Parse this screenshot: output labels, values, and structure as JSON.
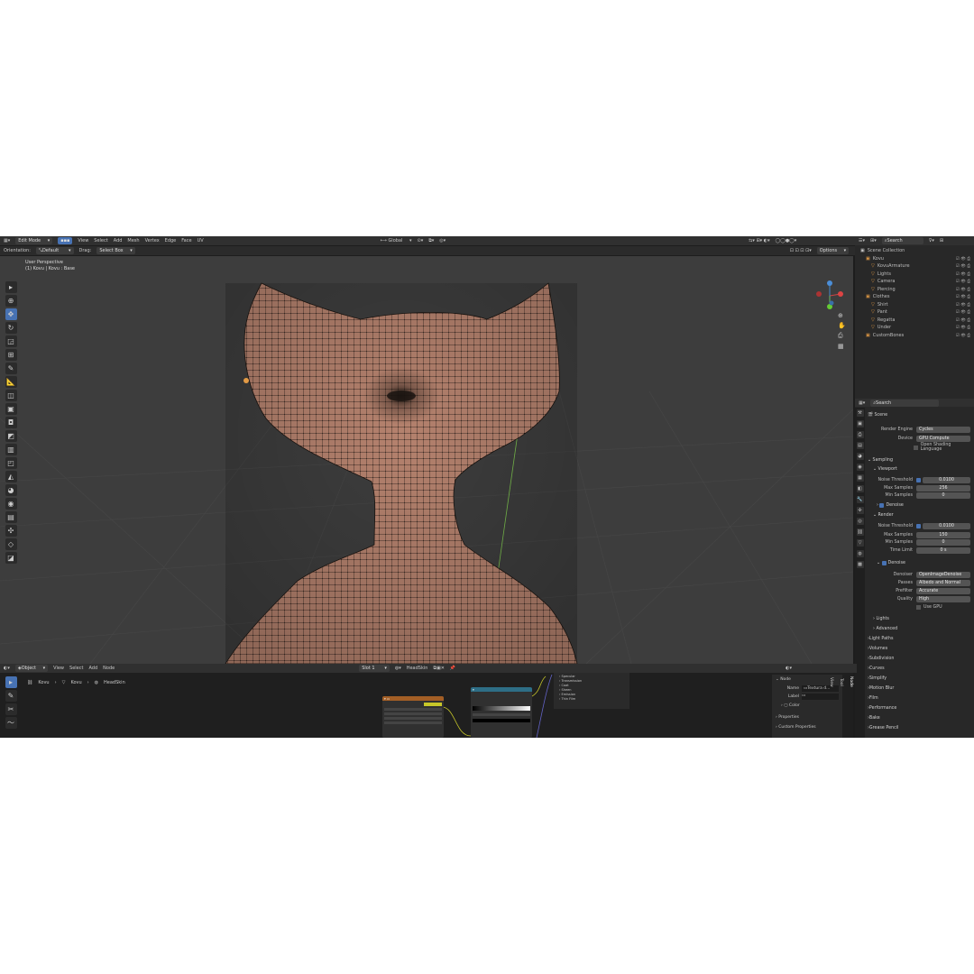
{
  "header": {
    "mode": "Edit Mode",
    "menus": [
      "View",
      "Select",
      "Add",
      "Mesh",
      "Vertex",
      "Edge",
      "Face",
      "UV"
    ],
    "orientation": "Global",
    "options": "Options"
  },
  "tool_header": {
    "orientation_label": "Orientation:",
    "orientation_value": "Default",
    "drag_label": "Drag:",
    "drag_value": "Select Box"
  },
  "viewport": {
    "title": "User Perspective",
    "subtitle": "(1) Kovu | Kovu : Base"
  },
  "outliner": {
    "search_placeholder": "Search",
    "scene_collection": "Scene Collection",
    "items": [
      {
        "name": "Kovu",
        "indent": 1
      },
      {
        "name": "KovuArmature",
        "indent": 2
      },
      {
        "name": "Lights",
        "indent": 2
      },
      {
        "name": "Camera",
        "indent": 2
      },
      {
        "name": "Piercing",
        "indent": 2
      },
      {
        "name": "Clothes",
        "indent": 1
      },
      {
        "name": "Shirt",
        "indent": 2
      },
      {
        "name": "Pant",
        "indent": 2
      },
      {
        "name": "Regatta",
        "indent": 2
      },
      {
        "name": "Under",
        "indent": 2
      },
      {
        "name": "CustomBones",
        "indent": 1
      }
    ]
  },
  "properties": {
    "search_placeholder": "Search",
    "context": "Scene",
    "render_engine_label": "Render Engine",
    "render_engine": "Cycles",
    "device_label": "Device",
    "device": "GPU Compute",
    "osl_label": "Open Shading Language",
    "sampling": "Sampling",
    "viewport": "Viewport",
    "noise_threshold_label": "Noise Threshold",
    "viewport_noise": "0.0100",
    "max_samples_label": "Max Samples",
    "viewport_max": "256",
    "min_samples_label": "Min Samples",
    "viewport_min": "0",
    "denoise": "Denoise",
    "render": "Render",
    "render_noise": "0.0100",
    "render_max": "150",
    "render_min": "0",
    "time_limit_label": "Time Limit",
    "time_limit": "0 s",
    "denoise2": "Denoise",
    "denoiser_label": "Denoiser",
    "denoiser": "OpenImageDenoise",
    "passes_label": "Passes",
    "passes": "Albedo and Normal",
    "prefilter_label": "Prefilter",
    "prefilter": "Accurate",
    "quality_label": "Quality",
    "quality": "High",
    "use_gpu": "Use GPU",
    "lights": "Lights",
    "advanced": "Advanced",
    "panels": [
      "Light Paths",
      "Volumes",
      "Subdivision",
      "Curves",
      "Simplify",
      "Motion Blur",
      "Film",
      "Performance",
      "Bake",
      "Grease Pencil"
    ]
  },
  "node_editor": {
    "mode": "Object",
    "menus": [
      "View",
      "Select",
      "Add",
      "Node"
    ],
    "slot": "Slot 1",
    "material": "HeadSkin",
    "breadcrumb": [
      "Kovu",
      "Kovu",
      "HeadSkin"
    ],
    "side_panel": {
      "node": "Node",
      "name_label": "Name",
      "name_value": "Textura d...",
      "label_label": "Label",
      "color": "Color",
      "properties": "Properties",
      "custom_properties": "Custom Properties"
    },
    "tabs": [
      "Node",
      "Tool",
      "View"
    ],
    "socket_list": [
      "Specular",
      "Transmission",
      "Coat",
      "Sheen",
      "Emission",
      "Thin Film"
    ]
  },
  "colors": {
    "accent": "#4772b3",
    "mesh": "#b5826e",
    "wire": "#1a1410"
  }
}
